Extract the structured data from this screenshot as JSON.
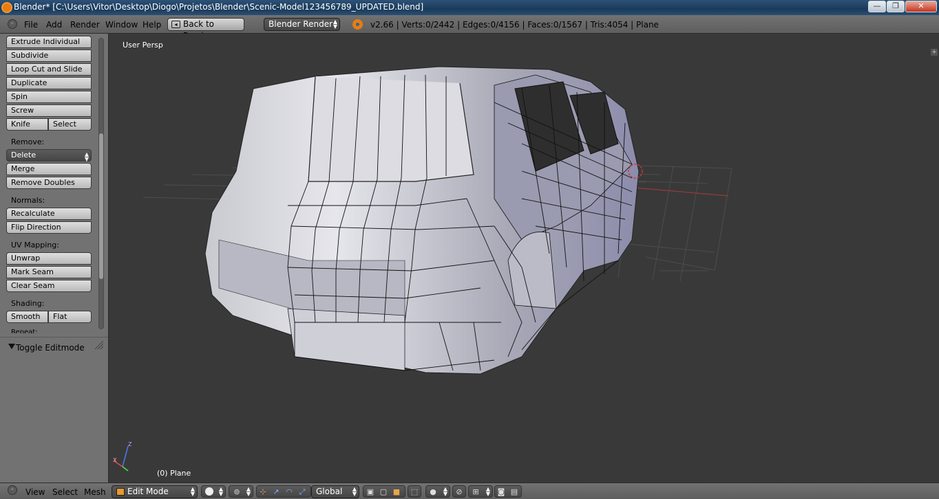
{
  "window": {
    "title": "Blender* [C:\\Users\\Vitor\\Desktop\\Diogo\\Projetos\\Blender\\Scenic-Model123456789_UPDATED.blend]",
    "minimize": "—",
    "maximize": "❐",
    "close": "✕"
  },
  "infobar": {
    "menus": [
      "File",
      "Add",
      "Render",
      "Window",
      "Help"
    ],
    "back_label": "Back to Previous",
    "engine": "Blender Render",
    "stats": "v2.66 | Verts:0/2442 | Edges:0/4156 | Faces:0/1567 | Tris:4054 | Plane"
  },
  "toolshelf": {
    "buttons": {
      "extrude_individual": "Extrude Individual",
      "subdivide": "Subdivide",
      "loop_cut": "Loop Cut and Slide",
      "duplicate": "Duplicate",
      "spin": "Spin",
      "screw": "Screw",
      "knife": "Knife",
      "select": "Select"
    },
    "remove_heading": "Remove:",
    "delete": "Delete",
    "merge": "Merge",
    "remove_doubles": "Remove Doubles",
    "normals_heading": "Normals:",
    "recalculate": "Recalculate",
    "flip_direction": "Flip Direction",
    "uv_heading": "UV Mapping:",
    "unwrap": "Unwrap",
    "mark_seam": "Mark Seam",
    "clear_seam": "Clear Seam",
    "shading_heading": "Shading:",
    "smooth": "Smooth",
    "flat": "Flat",
    "repeat_heading": "Repeat:",
    "operator_panel": "Toggle Editmode"
  },
  "viewport": {
    "view_name": "User Persp",
    "object_label": "(0) Plane"
  },
  "header3d": {
    "menus": [
      "View",
      "Select",
      "Mesh"
    ],
    "mode": "Edit Mode",
    "orientation": "Global"
  }
}
